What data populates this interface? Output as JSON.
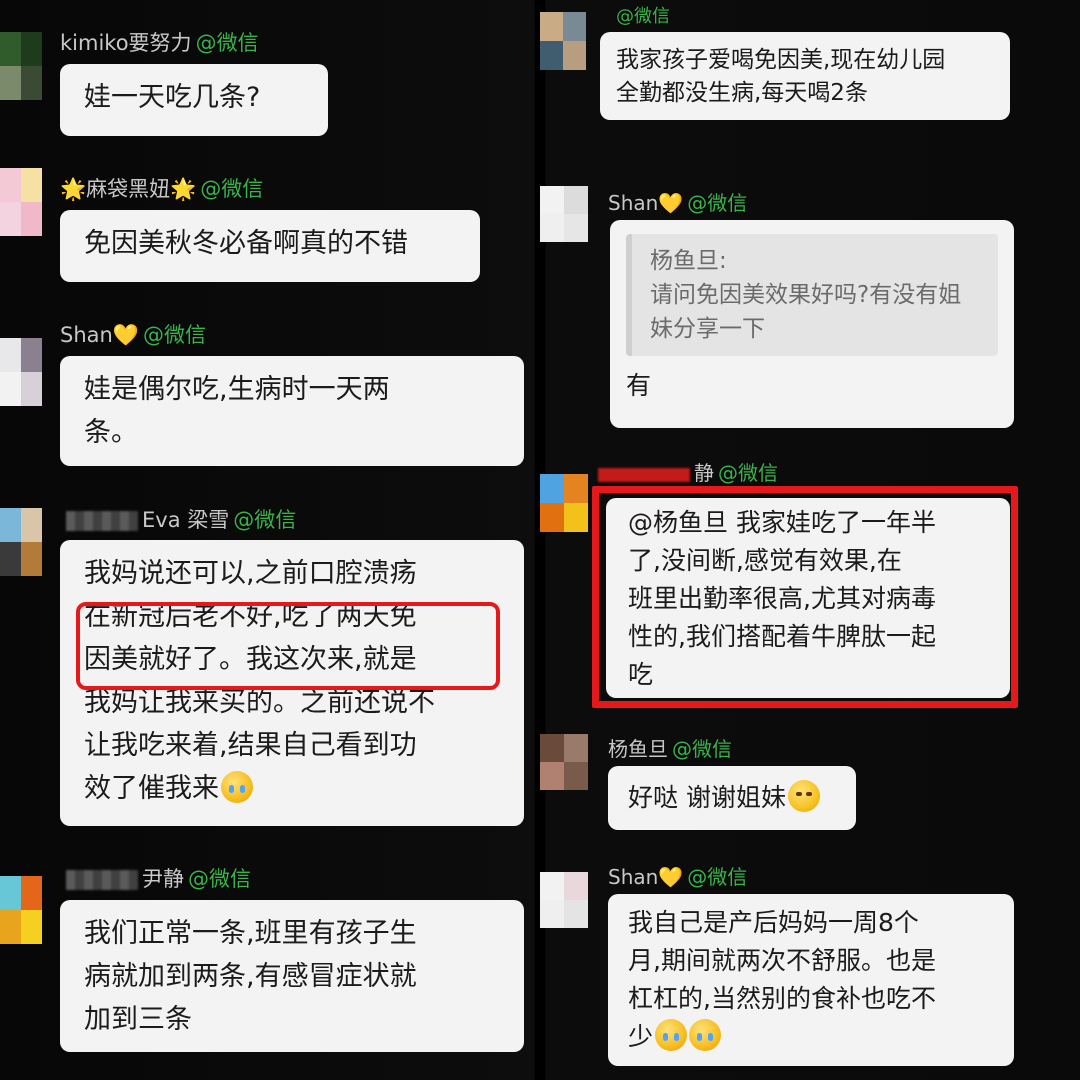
{
  "channel_tag": "@微信",
  "left_column": [
    {
      "name": "kimiko要努力",
      "avatar_colors": [
        "#2f5c2a",
        "#1e3b1b",
        "#7a8a6a",
        "#3b4a35"
      ],
      "text": "娃一天吃几条?"
    },
    {
      "name": "🌟麻袋黑妞🌟",
      "avatar_colors": [
        "#f4c9d6",
        "#f7e0a3",
        "#f2d3df",
        "#f0b8c8"
      ],
      "text": "免因美秋冬必备啊真的不错"
    },
    {
      "name": "Shan💛",
      "avatar_colors": [
        "#e8e8ea",
        "#8a8090",
        "#f2f2f2",
        "#d7d0d8"
      ],
      "text": "娃是偶尔吃,生病时一天两\n条。"
    },
    {
      "name": "Eva 梁雪",
      "avatar_colors": [
        "#7ab7d8",
        "#d9c6a8",
        "#3a3a3a",
        "#b37a3a"
      ],
      "text": "我妈说还可以,之前口腔溃疡\n在新冠后老不好,吃了两天免\n因美就好了。我这次来,就是\n我妈让我来买的。之前还说不\n让我吃来着,结果自己看到功\n效了催我来",
      "emoji": "cry"
    },
    {
      "name": "尹静",
      "avatar_colors": [
        "#68c7d6",
        "#e3661b",
        "#e8a41c",
        "#f5d020"
      ],
      "text": "我们正常一条,班里有孩子生\n病就加到两条,有感冒症状就\n加到三条"
    }
  ],
  "right_column": [
    {
      "name": "",
      "avatar_colors": [
        "#c9ab86",
        "#7a8a95",
        "#3f5d6e",
        "#b89e7f"
      ],
      "text": "我家孩子爱喝免因美,现在幼儿园\n全勤都没生病,每天喝2条"
    },
    {
      "name": "Shan💛",
      "avatar_colors": [
        "#f2f2f2",
        "#dcdcdc",
        "#efefef",
        "#e6e6e6"
      ],
      "quote_author": "杨鱼旦:",
      "quote_text": "请问免因美效果好吗?有没有姐\n妹分享一下",
      "text": "有"
    },
    {
      "name": "静",
      "avatar_colors": [
        "#4ea3e0",
        "#e38420",
        "#e07010",
        "#f2c21a"
      ],
      "text": "@杨鱼旦 我家娃吃了一年半\n了,没间断,感觉有效果,在\n班里出勤率很高,尤其对病毒\n性的,我们搭配着牛脾肽一起\n吃"
    },
    {
      "name": "杨鱼旦",
      "avatar_colors": [
        "#6a4a3a",
        "#9a7a6a",
        "#b08070",
        "#7a5a4a"
      ],
      "text": "好哒 谢谢姐妹",
      "emoji": "think"
    },
    {
      "name": "Shan💛",
      "avatar_colors": [
        "#f2f2f2",
        "#e8d8dc",
        "#efefef",
        "#e4e4e4"
      ],
      "text": "我自己是产后妈妈一周8个\n月,期间就两次不舒服。也是\n杠杠的,当然别的食补也吃不\n少",
      "emoji2": "laugh"
    }
  ]
}
